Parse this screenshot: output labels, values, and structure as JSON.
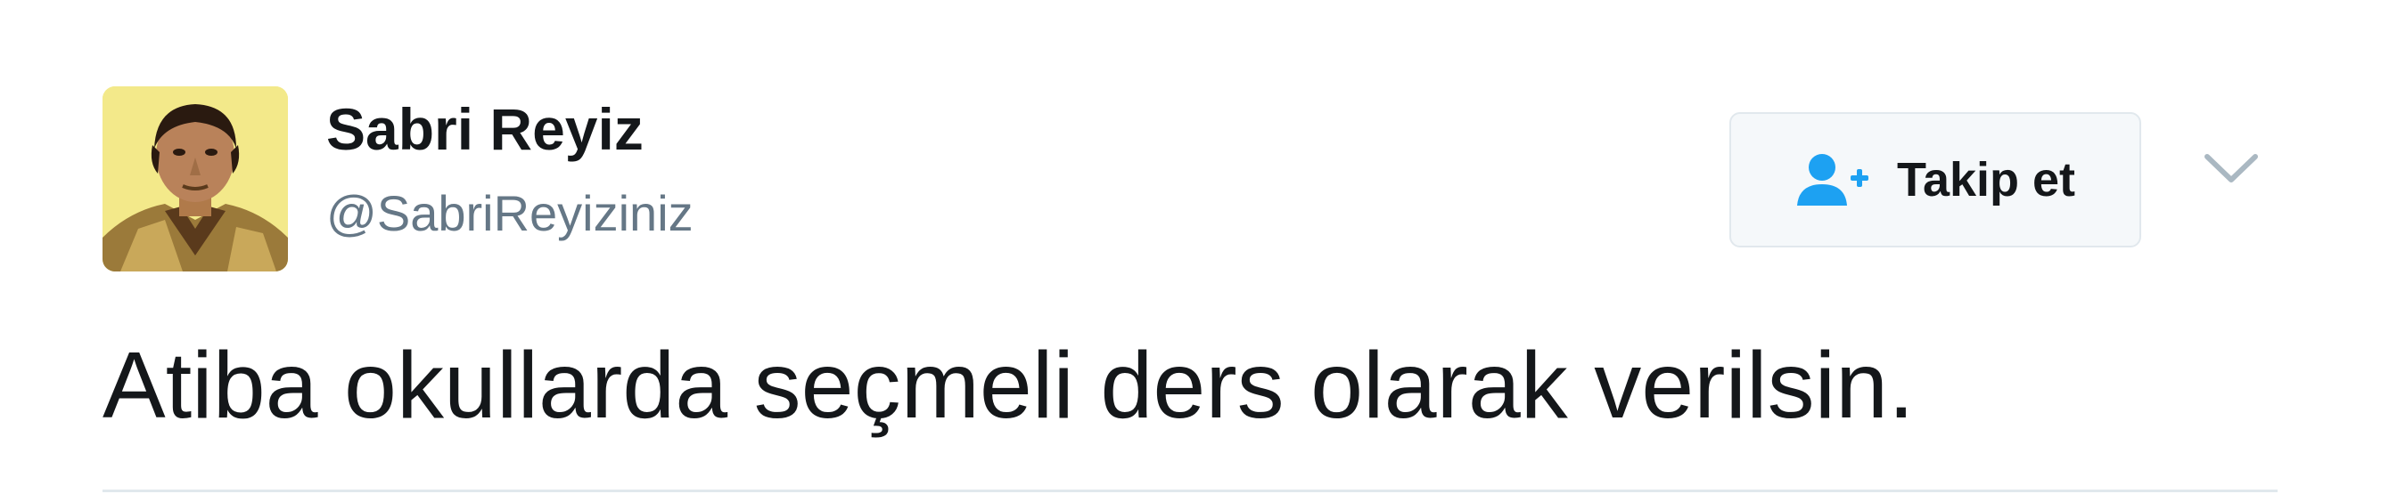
{
  "user": {
    "display_name": "Sabri Reyiz",
    "handle": "@SabriReyiziniz",
    "avatar_icon": "profile-photo"
  },
  "follow_button": {
    "label": "Takip et",
    "icon": "add-user-icon"
  },
  "menu": {
    "icon": "chevron-down-icon"
  },
  "tweet": {
    "text": "Atiba okullarda seçmeli ders olarak verilsin."
  },
  "colors": {
    "text": "#14171a",
    "secondary_text": "#657786",
    "accent": "#1da1f2",
    "button_border": "#e1e8ed",
    "button_bg": "#f5f8fa",
    "avatar_bg": "#f3e98a"
  }
}
